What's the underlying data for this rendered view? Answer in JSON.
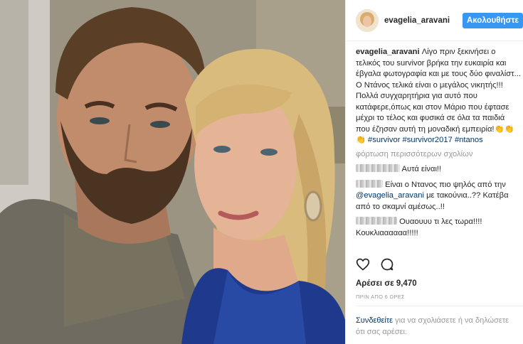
{
  "header": {
    "username": "evagelia_aravani",
    "follow_label": "Ακολουθήστε"
  },
  "caption": {
    "username": "evagelia_aravani",
    "text": "Λίγο πριν ξεκινήσει ο τελικός του survivor βρήκα την ευκαιρία και έβγαλα φωτογραφία και με τους δύο φιναλίστ...\nΟ Ντάνος τελικά είναι ο μεγάλος νικητής!!! Πολλά συγχαρητήρια για αυτό που κατάφερε,όπως και στον Μάριο που έφτασε μέχρι το τέλος και φυσικά σε όλα τα παιδιά που έζησαν αυτή τη μοναδική εμπειρία!👏👏👏",
    "hashtags": [
      "#survivor",
      "#survivor2017",
      "#ntanos"
    ]
  },
  "load_more_label": "φόρτωση περισσότερων σχολίων",
  "comments": [
    {
      "text": "Αυτά είναι!!"
    },
    {
      "text_before": "Είναι ο Ντανος πιο ψηλός από την",
      "mention": "@evagelia_aravani",
      "text_after": "με τακούνια..?? Κατέβα από το σκαμνί αμέσως..!!"
    },
    {
      "text": "Ουαουυυ τι λες τωρα!!!! Κουκλιαααααα!!!!!"
    }
  ],
  "actions": {
    "like_icon": "heart-icon",
    "comment_icon": "comment-icon"
  },
  "likes_label": "Αρέσει σε 9,470",
  "timestamp": "ΠΡΙΝ ΑΠΟ 6 ΩΡΕΣ",
  "login_prompt": {
    "link": "Συνδεθείτε",
    "text": "για να σχολιάσετε ή να δηλώσετε ότι σας αρέσει."
  }
}
